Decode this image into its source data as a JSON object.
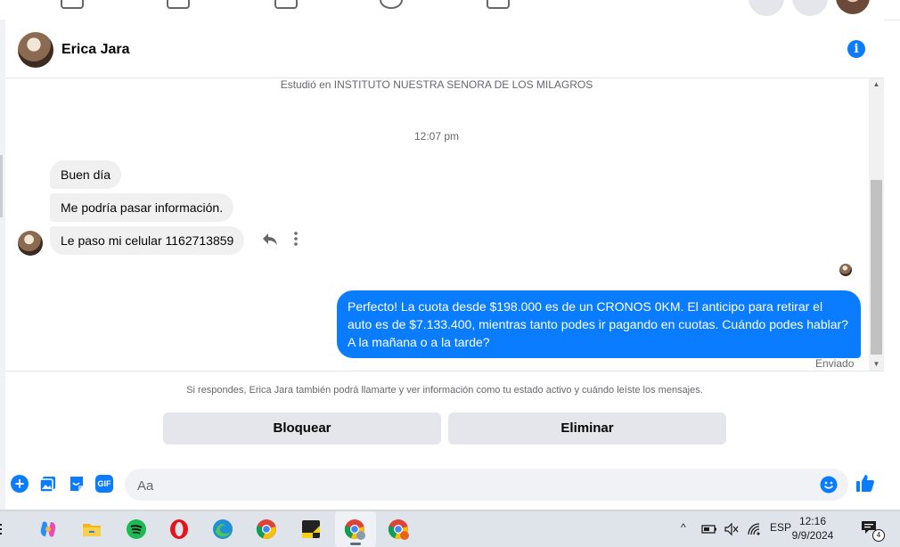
{
  "contact": {
    "name": "Erica Jara"
  },
  "thread": {
    "studied": "Estudió en INSTITUTO NUESTRA SENORA DE LOS MILAGROS",
    "timestamp": "12:07 pm",
    "incoming": [
      "Buen día",
      "Me podría pasar información.",
      "Le paso mi celular 1162713859"
    ],
    "outgoing": "Perfecto! La cuota desde $198.000 es de un CRONOS 0KM. El anticipo para retirar el auto es de $7.133.400, mientras tanto podes ir pagando en cuotas. Cuándo podes hablar? A la mañana o a la tarde?",
    "status": "Enviado"
  },
  "notice": {
    "text": "Si respondes, Erica Jara también podrá llamarte y ver información como tu estado activo y cuándo leíste los mensajes.",
    "block_label": "Bloquear",
    "delete_label": "Eliminar"
  },
  "composer": {
    "placeholder": "Aa",
    "gif_label": "GIF"
  },
  "taskbar": {
    "language": "ESP",
    "time": "12:16",
    "date": "9/9/2024",
    "notification_count": "4"
  },
  "colors": {
    "accent": "#0a7cff",
    "incoming_bubble": "#f0f0f0",
    "taskbar": "#dfe3ea"
  },
  "icons": [
    "info-icon",
    "reply-icon",
    "more-vertical-icon",
    "plus-icon",
    "photo-icon",
    "sticker-icon",
    "gif-icon",
    "emoji-icon",
    "like-icon"
  ]
}
